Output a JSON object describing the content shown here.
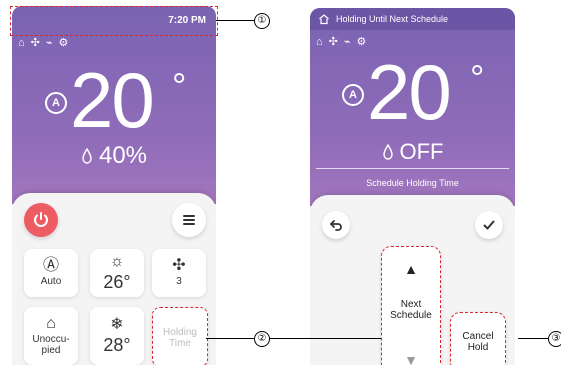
{
  "callouts": [
    "①",
    "②",
    "③"
  ],
  "left": {
    "time": "7:20 PM",
    "temperature": "20",
    "degree": "°",
    "humidity": "40%",
    "mode_badge": "A",
    "tiles": {
      "mode_label": "Auto",
      "temp_cool": "26°",
      "fan_speed": "3",
      "occupancy_label": "Unoccu-\npied",
      "temp_heat": "28°",
      "holding_time_label": "Holding\nTime"
    }
  },
  "right": {
    "header": "Holding Until Next Schedule",
    "temperature": "20",
    "degree": "°",
    "humidity": "OFF",
    "mode_badge": "A",
    "schedule_label": "Schedule Holding Time",
    "next_schedule_label": "Next\nSchedule",
    "cancel_hold_label": "Cancel\nHold"
  },
  "icons": {
    "status": [
      "home-arrow-icon",
      "fan-icon",
      "lock-icon",
      "settings-icon"
    ],
    "power": "power-icon",
    "menu": "menu-icon",
    "back": "back-icon",
    "check": "check-icon",
    "chevron_up": "chevron-up-icon",
    "chevron_down": "chevron-down-icon"
  },
  "colors": {
    "purple_top": "#7a63b2",
    "purple_bottom": "#a276bd",
    "power_red": "#ee5c63",
    "dashed_red": "#d62b2b"
  }
}
